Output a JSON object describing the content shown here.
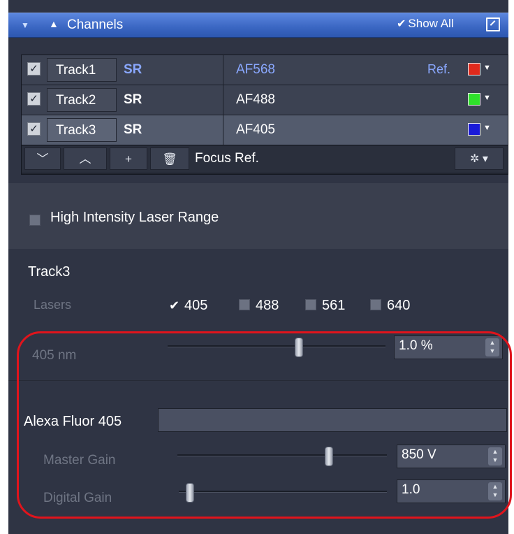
{
  "header": {
    "title": "Channels",
    "show_all_label": "Show All"
  },
  "tracks": [
    {
      "name": "Track1",
      "mode": "SR",
      "dye": "AF568",
      "ref_label": "Ref.",
      "color": "#e02a1c",
      "checked": true,
      "selected": false
    },
    {
      "name": "Track2",
      "mode": "SR",
      "dye": "AF488",
      "ref_label": "",
      "color": "#2ee02a",
      "checked": true,
      "selected": false
    },
    {
      "name": "Track3",
      "mode": "SR",
      "dye": "AF405",
      "ref_label": "",
      "color": "#1a1ad8",
      "checked": true,
      "selected": true
    }
  ],
  "toolbar": {
    "focus_ref_label": "Focus Ref."
  },
  "high_intensity": {
    "label": "High Intensity Laser Range",
    "checked": false
  },
  "track_settings": {
    "title": "Track3",
    "lasers_label": "Lasers",
    "lasers": [
      {
        "label": "405",
        "checked": true
      },
      {
        "label": "488",
        "checked": false
      },
      {
        "label": "561",
        "checked": false
      },
      {
        "label": "640",
        "checked": false
      }
    ],
    "laser_power": {
      "label": "405 nm",
      "value": "1.0 %",
      "level": 0.6
    },
    "dye_name": "Alexa Fluor 405",
    "master_gain": {
      "label": "Master Gain",
      "value": "850 V",
      "level": 0.72
    },
    "digital_gain": {
      "label": "Digital Gain",
      "value": "1.0",
      "level": 0.05
    }
  },
  "colors": {
    "accent_header": "#3a66c2",
    "panel_bg": "#2f3444",
    "annotation": "#e0141c"
  }
}
